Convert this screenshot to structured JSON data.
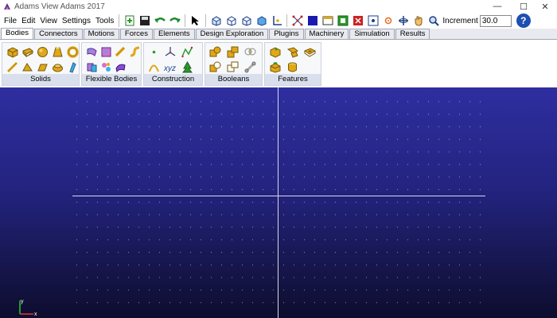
{
  "window": {
    "title": "Adams View Adams 2017"
  },
  "menu": [
    "File",
    "Edit",
    "View",
    "Settings",
    "Tools"
  ],
  "toolbar": {
    "increment_label": "Increment",
    "increment_value": "30.0"
  },
  "tabs": [
    "Bodies",
    "Connectors",
    "Motions",
    "Forces",
    "Elements",
    "Design Exploration",
    "Plugins",
    "Machinery",
    "Simulation",
    "Results"
  ],
  "ribbon": {
    "groups": [
      "Solids",
      "Flexible Bodies",
      "Construction",
      "Booleans",
      "Features"
    ]
  },
  "viewport": {
    "triad": {
      "y_label": "y",
      "x_label": "x"
    }
  },
  "colors": {
    "viewport_top": "#2e2ea0",
    "viewport_bottom": "#0d0d2e",
    "solid_icon": "#e0a817"
  }
}
